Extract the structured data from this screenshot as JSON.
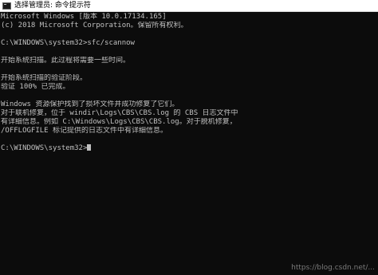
{
  "window": {
    "title": "选择管理员: 命令提示符",
    "icon": "cmd-icon"
  },
  "console": {
    "lines": [
      "Microsoft Windows [版本 10.0.17134.165]",
      "(c) 2018 Microsoft Corporation。保留所有权利。",
      "",
      "C:\\WINDOWS\\system32>sfc/scannow",
      "",
      "开始系统扫描。此过程将需要一些时间。",
      "",
      "开始系统扫描的验证阶段。",
      "验证 100% 已完成。",
      "",
      "Windows 资源保护找到了损坏文件并成功修复了它们。",
      "对于联机修复，位于 windir\\Logs\\CBS\\CBS.log 的 CBS 日志文件中",
      "有详细信息。例如 C:\\Windows\\Logs\\CBS\\CBS.log。对于脱机修复，",
      "/OFFLOGFILE 标记提供的日志文件中有详细信息。",
      "",
      "C:\\WINDOWS\\system32>"
    ]
  },
  "watermark": "https://blog.csdn.net/...",
  "colors": {
    "console_bg": "#0c0c0c",
    "console_text": "#c0c0c0",
    "titlebar_bg": "#ffffff"
  }
}
